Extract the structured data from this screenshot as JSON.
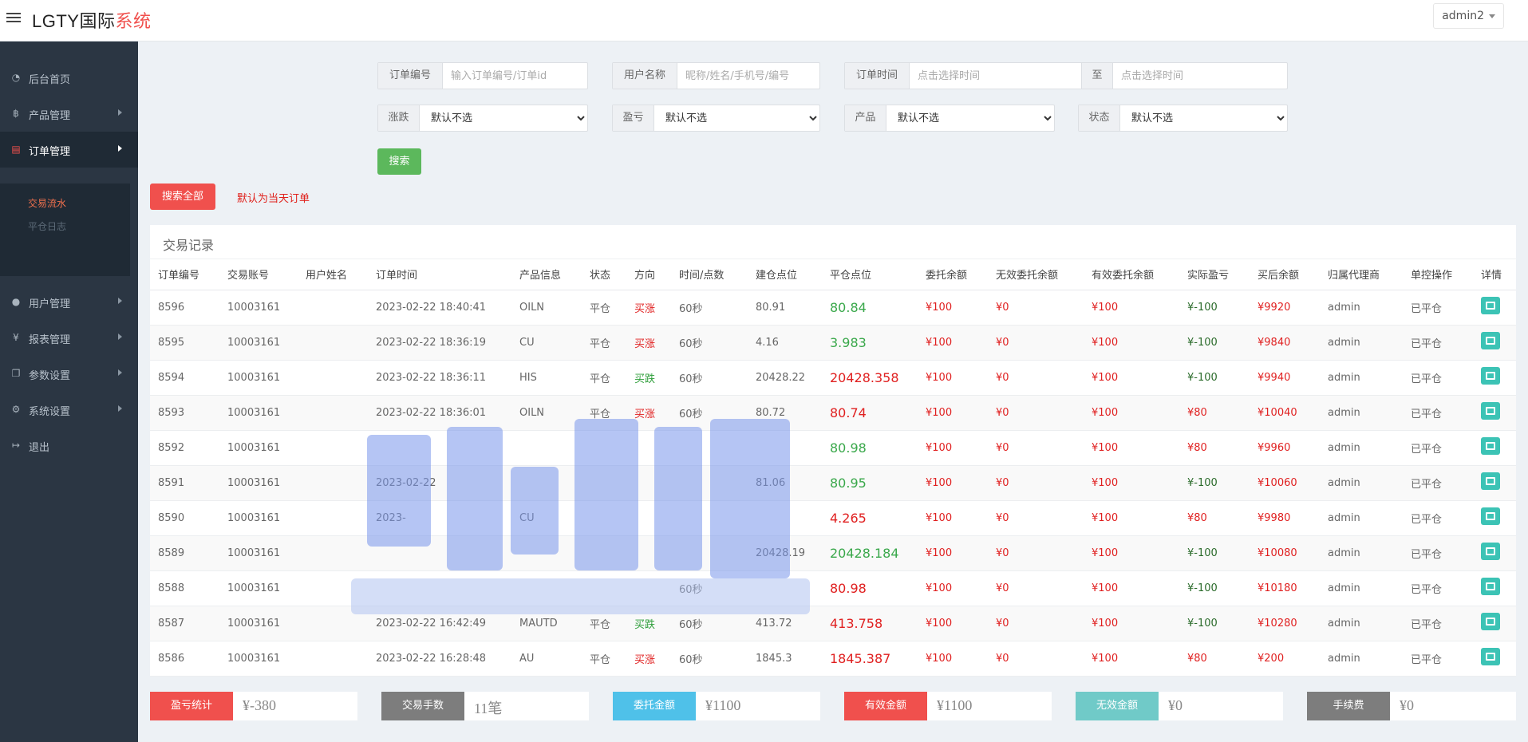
{
  "app": {
    "logo_main": "LGTY国际",
    "logo_accent": "系统",
    "user": "admin2"
  },
  "sidebar": {
    "items": [
      {
        "label": "后台首页",
        "icon": "dashboard-icon"
      },
      {
        "label": "产品管理",
        "icon": "bitcoin-icon"
      },
      {
        "label": "订单管理",
        "icon": "orders-icon"
      },
      {
        "label": "用户管理",
        "icon": "user-icon"
      },
      {
        "label": "报表管理",
        "icon": "yen-icon"
      },
      {
        "label": "参数设置",
        "icon": "copy-icon"
      },
      {
        "label": "系统设置",
        "icon": "gears-icon"
      },
      {
        "label": "退出",
        "icon": "logout-icon"
      }
    ],
    "sub_items": [
      {
        "label": "交易流水"
      },
      {
        "label": "平仓日志"
      }
    ]
  },
  "filters": {
    "order_no_label": "订单编号",
    "order_no_placeholder": "输入订单编号/订单id",
    "user_name_label": "用户名称",
    "user_name_placeholder": "昵称/姓名/手机号/编号",
    "order_time_label": "订单时间",
    "time_start_placeholder": "点击选择时间",
    "to_label": "至",
    "time_end_placeholder": "点击选择时间",
    "rise_fall_label": "涨跌",
    "profit_label": "盈亏",
    "product_label": "产品",
    "status_label": "状态",
    "default_option": "默认不选",
    "search_button": "搜索",
    "search_all_button": "搜索全部",
    "hint": "默认为当天订单"
  },
  "table": {
    "title": "交易记录",
    "headers": [
      "订单编号",
      "交易账号",
      "用户姓名",
      "订单时间",
      "产品信息",
      "状态",
      "方向",
      "时间/点数",
      "建仓点位",
      "平仓点位",
      "委托余额",
      "无效委托余额",
      "有效委托余额",
      "实际盈亏",
      "买后余额",
      "归属代理商",
      "单控操作",
      "详情"
    ],
    "rows": [
      {
        "id": "8596",
        "account": "10003161",
        "name": "",
        "time": "2023-02-22 18:40:41",
        "product": "OILN",
        "status": "平仓",
        "dir": "买涨",
        "period": "60秒",
        "open": "80.91",
        "close": "80.84",
        "close_color": "green",
        "entrust": "¥100",
        "invalid": "¥0",
        "valid": "¥100",
        "pnl": "¥-100",
        "balance": "¥9920",
        "agent": "admin",
        "op": "已平仓"
      },
      {
        "id": "8595",
        "account": "10003161",
        "name": "",
        "time": "2023-02-22 18:36:19",
        "product": "CU",
        "status": "平仓",
        "dir": "买涨",
        "period": "60秒",
        "open": "4.16",
        "close": "3.983",
        "close_color": "green",
        "entrust": "¥100",
        "invalid": "¥0",
        "valid": "¥100",
        "pnl": "¥-100",
        "balance": "¥9840",
        "agent": "admin",
        "op": "已平仓"
      },
      {
        "id": "8594",
        "account": "10003161",
        "name": "",
        "time": "2023-02-22 18:36:11",
        "product": "HIS",
        "status": "平仓",
        "dir": "买跌",
        "period": "60秒",
        "open": "20428.22",
        "close": "20428.358",
        "close_color": "red",
        "entrust": "¥100",
        "invalid": "¥0",
        "valid": "¥100",
        "pnl": "¥-100",
        "balance": "¥9940",
        "agent": "admin",
        "op": "已平仓"
      },
      {
        "id": "8593",
        "account": "10003161",
        "name": "",
        "time": "2023-02-22 18:36:01",
        "product": "OILN",
        "status": "平仓",
        "dir": "买涨",
        "period": "60秒",
        "open": "80.72",
        "close": "80.74",
        "close_color": "red",
        "entrust": "¥100",
        "invalid": "¥0",
        "valid": "¥100",
        "pnl": "¥80",
        "balance": "¥10040",
        "agent": "admin",
        "op": "已平仓"
      },
      {
        "id": "8592",
        "account": "10003161",
        "name": "",
        "time": "",
        "product": "",
        "status": "",
        "dir": "",
        "period": "",
        "open": "",
        "close": "80.98",
        "close_color": "green",
        "entrust": "¥100",
        "invalid": "¥0",
        "valid": "¥100",
        "pnl": "¥80",
        "balance": "¥9960",
        "agent": "admin",
        "op": "已平仓"
      },
      {
        "id": "8591",
        "account": "10003161",
        "name": "",
        "time": "2023-02-22",
        "product": "",
        "status": "",
        "dir": "",
        "period": "",
        "open": "81.06",
        "close": "80.95",
        "close_color": "green",
        "entrust": "¥100",
        "invalid": "¥0",
        "valid": "¥100",
        "pnl": "¥-100",
        "balance": "¥10060",
        "agent": "admin",
        "op": "已平仓"
      },
      {
        "id": "8590",
        "account": "10003161",
        "name": "",
        "time": "2023-",
        "product": "CU",
        "status": "",
        "dir": "",
        "period": "",
        "open": "",
        "close": "4.265",
        "close_color": "red",
        "entrust": "¥100",
        "invalid": "¥0",
        "valid": "¥100",
        "pnl": "¥80",
        "balance": "¥9980",
        "agent": "admin",
        "op": "已平仓"
      },
      {
        "id": "8589",
        "account": "10003161",
        "name": "",
        "time": "",
        "product": "",
        "status": "",
        "dir": "",
        "period": "",
        "open": "20428.19",
        "close": "20428.184",
        "close_color": "green",
        "entrust": "¥100",
        "invalid": "¥0",
        "valid": "¥100",
        "pnl": "¥-100",
        "balance": "¥10080",
        "agent": "admin",
        "op": "已平仓"
      },
      {
        "id": "8588",
        "account": "10003161",
        "name": "",
        "time": "",
        "product": "",
        "status": "",
        "dir": "",
        "period": "60秒",
        "open": "",
        "close": "80.98",
        "close_color": "red",
        "entrust": "¥100",
        "invalid": "¥0",
        "valid": "¥100",
        "pnl": "¥-100",
        "balance": "¥10180",
        "agent": "admin",
        "op": "已平仓"
      },
      {
        "id": "8587",
        "account": "10003161",
        "name": "",
        "time": "2023-02-22 16:42:49",
        "product": "MAUTD",
        "status": "平仓",
        "dir": "买跌",
        "period": "60秒",
        "open": "413.72",
        "close": "413.758",
        "close_color": "red",
        "entrust": "¥100",
        "invalid": "¥0",
        "valid": "¥100",
        "pnl": "¥-100",
        "balance": "¥10280",
        "agent": "admin",
        "op": "已平仓"
      },
      {
        "id": "8586",
        "account": "10003161",
        "name": "",
        "time": "2023-02-22 16:28:48",
        "product": "AU",
        "status": "平仓",
        "dir": "买涨",
        "period": "60秒",
        "open": "1845.3",
        "close": "1845.387",
        "close_color": "red",
        "entrust": "¥100",
        "invalid": "¥0",
        "valid": "¥100",
        "pnl": "¥80",
        "balance": "¥200",
        "agent": "admin",
        "op": "已平仓"
      }
    ]
  },
  "stats": [
    {
      "label": "盈亏统计",
      "value": "¥-380",
      "color": "#f0504d"
    },
    {
      "label": "交易手数",
      "value": "11笔",
      "color": "#7d7d7d"
    },
    {
      "label": "委托金额",
      "value": "¥1100",
      "color": "#4fc1e9"
    },
    {
      "label": "有效金额",
      "value": "¥1100",
      "color": "#f0504d"
    },
    {
      "label": "无效金额",
      "value": "¥0",
      "color": "#70cac8"
    },
    {
      "label": "手续费",
      "value": "¥0",
      "color": "#7d7d7d"
    }
  ]
}
